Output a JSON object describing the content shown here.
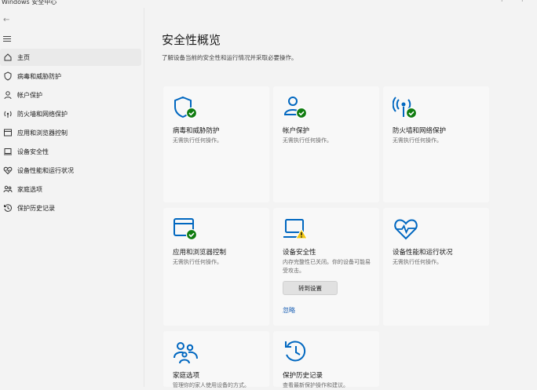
{
  "window": {
    "title": "Windows 安全中心",
    "btn1": "‧",
    "btn2": "‧"
  },
  "sidebar": {
    "items": [
      {
        "label": "主页",
        "icon": "home-icon"
      },
      {
        "label": "病毒和威胁防护",
        "icon": "shield-icon"
      },
      {
        "label": "帐户保护",
        "icon": "person-icon"
      },
      {
        "label": "防火墙和网络保护",
        "icon": "wifi-icon"
      },
      {
        "label": "应用和浏览器控制",
        "icon": "browser-icon"
      },
      {
        "label": "设备安全性",
        "icon": "laptop-icon"
      },
      {
        "label": "设备性能和运行状况",
        "icon": "heart-icon"
      },
      {
        "label": "家庭选项",
        "icon": "family-icon"
      },
      {
        "label": "保护历史记录",
        "icon": "history-icon"
      }
    ]
  },
  "main": {
    "title": "安全性概览",
    "subtitle": "了解设备当前的安全性和运行情况并采取必要操作。",
    "cards": [
      {
        "title": "病毒和威胁防护",
        "desc": "无需执行任何操作。"
      },
      {
        "title": "帐户保护",
        "desc": "无需执行任何操作。"
      },
      {
        "title": "防火墙和网络保护",
        "desc": "无需执行任何操作。"
      },
      {
        "title": "应用和浏览器控制",
        "desc": "无需执行任何操作。"
      },
      {
        "title": "设备安全性",
        "desc": "内存完整性已关闭。你的设备可能易受攻击。",
        "button": "转到设置",
        "link": "忽略"
      },
      {
        "title": "设备性能和运行状况",
        "desc": "无需执行任何操作。"
      },
      {
        "title": "家庭选项",
        "desc": "管理你的家人使用设备的方式。"
      },
      {
        "title": "保护历史记录",
        "desc": "查看最新保护操作和建议。"
      }
    ]
  },
  "colors": {
    "accent": "#0067c0",
    "ok": "#107c10",
    "warn": "#f2c811"
  }
}
